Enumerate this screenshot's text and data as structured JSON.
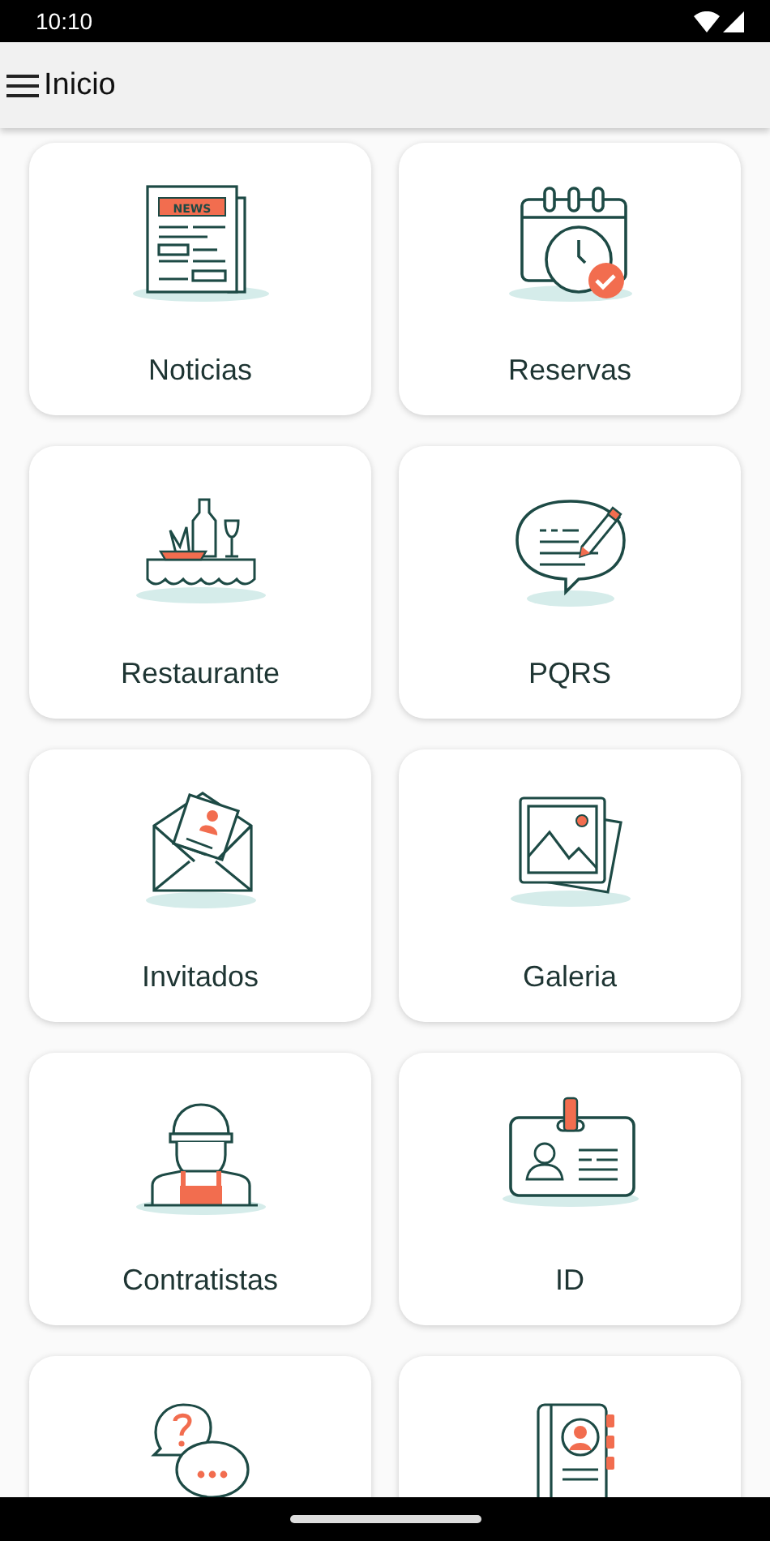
{
  "status_bar": {
    "time": "10:10"
  },
  "app_bar": {
    "title": "Inicio"
  },
  "tiles": [
    {
      "kind": "full",
      "label": "Noticias",
      "icon_text": "NEWS"
    },
    {
      "kind": "full",
      "label": "Reservas"
    },
    {
      "kind": "full",
      "label": "Restaurante"
    },
    {
      "kind": "full",
      "label": "PQRS"
    },
    {
      "kind": "full",
      "label": "Invitados"
    },
    {
      "kind": "full",
      "label": "Galeria"
    },
    {
      "kind": "full",
      "label": "Contratistas"
    },
    {
      "kind": "full",
      "label": "ID"
    },
    {
      "kind": "partial"
    },
    {
      "kind": "partial"
    }
  ]
}
